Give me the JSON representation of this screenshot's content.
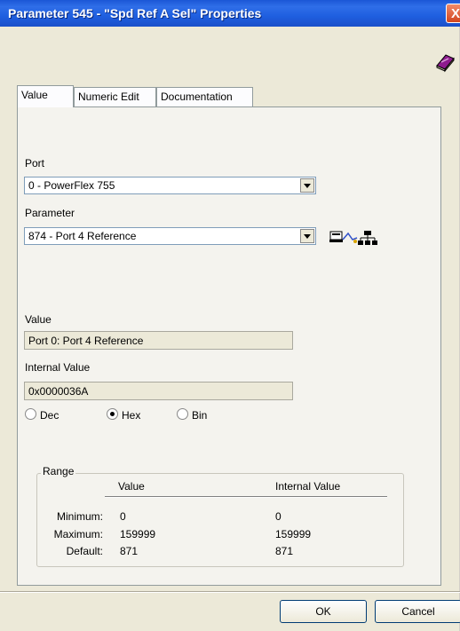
{
  "window": {
    "title": "Parameter 545 - \"Spd Ref A Sel\" Properties",
    "close": "X"
  },
  "tabs": [
    {
      "label": "Value"
    },
    {
      "label": "Numeric Edit"
    },
    {
      "label": "Documentation"
    }
  ],
  "port": {
    "label": "Port",
    "value": "0 - PowerFlex 755"
  },
  "parameter": {
    "label": "Parameter",
    "value": "874 - Port 4 Reference"
  },
  "value": {
    "label": "Value",
    "text": "Port 0: Port 4 Reference"
  },
  "internal_value": {
    "label": "Internal Value",
    "text": "0x0000036A"
  },
  "radix": {
    "options": [
      "Dec",
      "Hex",
      "Bin"
    ],
    "selected": "Hex"
  },
  "range": {
    "title": "Range",
    "columns": [
      "Value",
      "Internal Value"
    ],
    "rows": [
      {
        "label": "Minimum:",
        "value": "0",
        "internal": "0"
      },
      {
        "label": "Maximum:",
        "value": "159999",
        "internal": "159999"
      },
      {
        "label": "Default:",
        "value": "871",
        "internal": "871"
      }
    ]
  },
  "buttons": {
    "ok": "OK",
    "cancel": "Cancel"
  },
  "icons": {
    "help": "help-book-icon",
    "link": "network-link-icon"
  }
}
